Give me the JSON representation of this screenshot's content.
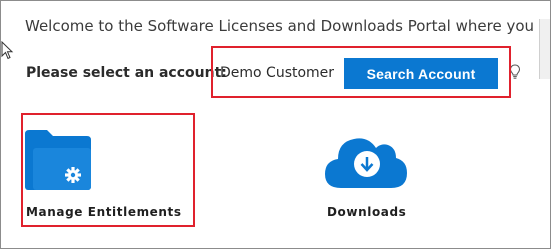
{
  "welcome_text": "Welcome to the Software Licenses and Downloads Portal where you can a",
  "account": {
    "label": "Please select an account:",
    "value": "Demo Customer",
    "search_button": "Search Account"
  },
  "tiles": [
    {
      "label": "Manage Entitlements",
      "icon": "folder-gear-icon"
    },
    {
      "label": "Downloads",
      "icon": "cloud-download-icon"
    }
  ],
  "colors": {
    "accent": "#0b78d1",
    "highlight": "#e0212d"
  }
}
